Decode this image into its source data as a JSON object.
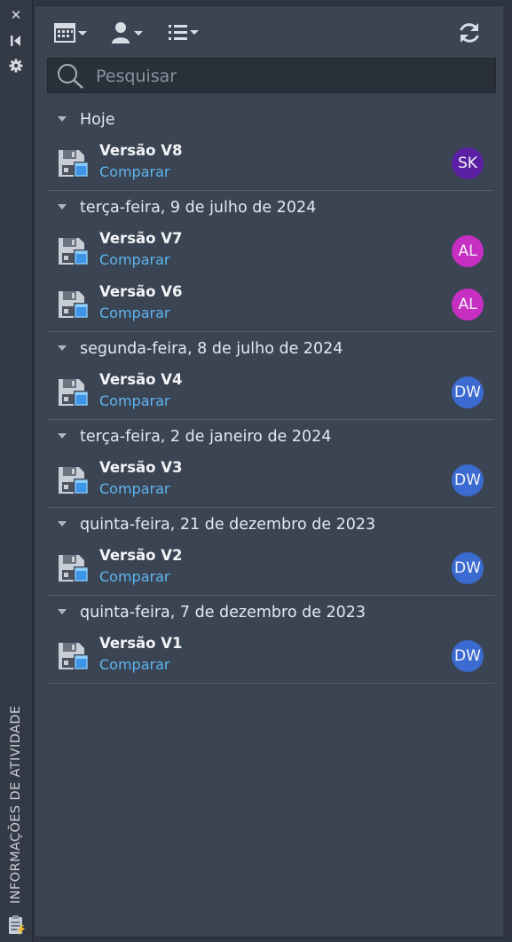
{
  "side_strip": {
    "title": "INFORMAÇÕES DE ATIVIDADE",
    "close_icon": "close-icon",
    "collapse_icon": "collapse-left-icon",
    "settings_icon": "gear-icon"
  },
  "toolbar": {
    "buttons": [
      "calendar-filter-icon",
      "user-filter-icon",
      "list-view-icon",
      "refresh-icon"
    ]
  },
  "search": {
    "placeholder": "Pesquisar"
  },
  "colors": {
    "accent_link": "#5db6ee",
    "avatar_sk": "#5a1fa3",
    "avatar_al": "#c62fc2",
    "avatar_dw": "#3b6bd0"
  },
  "groups": [
    {
      "title": "Hoje",
      "items": [
        {
          "name": "Versão V8",
          "action": "Comparar",
          "user": "SK",
          "color": "#5a1fa3"
        }
      ]
    },
    {
      "title": "terça-feira, 9 de julho de 2024",
      "items": [
        {
          "name": "Versão V7",
          "action": "Comparar",
          "user": "AL",
          "color": "#c62fc2"
        },
        {
          "name": "Versão V6",
          "action": "Comparar",
          "user": "AL",
          "color": "#c62fc2"
        }
      ]
    },
    {
      "title": "segunda-feira, 8 de julho de 2024",
      "items": [
        {
          "name": "Versão V4",
          "action": "Comparar",
          "user": "DW",
          "color": "#3b6bd0"
        }
      ]
    },
    {
      "title": "terça-feira, 2 de janeiro de 2024",
      "items": [
        {
          "name": "Versão V3",
          "action": "Comparar",
          "user": "DW",
          "color": "#3b6bd0"
        }
      ]
    },
    {
      "title": "quinta-feira, 21 de dezembro de 2023",
      "items": [
        {
          "name": "Versão V2",
          "action": "Comparar",
          "user": "DW",
          "color": "#3b6bd0"
        }
      ]
    },
    {
      "title": "quinta-feira, 7 de dezembro de 2023",
      "items": [
        {
          "name": "Versão V1",
          "action": "Comparar",
          "user": "DW",
          "color": "#3b6bd0"
        }
      ]
    }
  ]
}
